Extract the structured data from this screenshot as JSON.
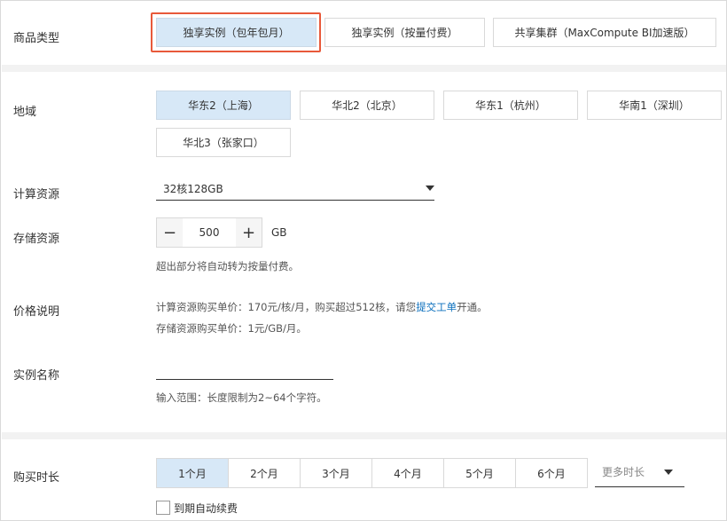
{
  "product_type": {
    "label": "商品类型",
    "options": [
      "独享实例（包年包月）",
      "独享实例（按量付费）",
      "共享集群（MaxCompute BI加速版）"
    ]
  },
  "region": {
    "label": "地域",
    "options": [
      "华东2（上海）",
      "华北2（北京）",
      "华东1（杭州）",
      "华南1（深圳）",
      "华北3（张家口）"
    ]
  },
  "compute": {
    "label": "计算资源",
    "value": "32核128GB"
  },
  "storage": {
    "label": "存储资源",
    "value": "500",
    "minus": "−",
    "plus": "+",
    "unit": "GB",
    "hint": "超出部分将自动转为按量付费。"
  },
  "price": {
    "label": "价格说明",
    "line1_pre": "计算资源购买单价：170元/核/月，购买超过512核，请您",
    "line1_link": "提交工单",
    "line1_post": "开通。",
    "line2": "存储资源购买单价：1元/GB/月。"
  },
  "instance_name": {
    "label": "实例名称",
    "hint": "输入范围：长度限制为2~64个字符。"
  },
  "duration": {
    "label": "购买时长",
    "options": [
      "1个月",
      "2个月",
      "3个月",
      "4个月",
      "5个月",
      "6个月"
    ],
    "more": "更多时长",
    "auto_renew": "到期自动续费"
  }
}
